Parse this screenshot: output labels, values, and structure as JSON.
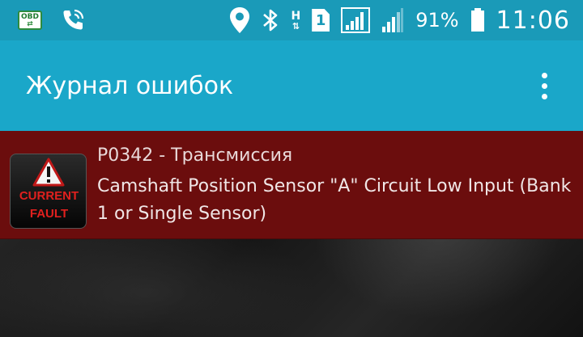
{
  "status_bar": {
    "obd_label": "OBD",
    "network_label": "H",
    "sim_label": "1",
    "battery_percent": "91%",
    "time": "11:06",
    "icons": [
      "obd-icon",
      "phone-wifi-icon",
      "location-icon",
      "bluetooth-icon",
      "network-h-icon",
      "sim-1-icon",
      "signal-icon",
      "signal-icon",
      "battery-icon"
    ]
  },
  "app_bar": {
    "title": "Журнал ошибок",
    "menu_icon": "overflow-menu-icon"
  },
  "errors": [
    {
      "icon_line1": "CURRENT",
      "icon_line2": "FAULT",
      "code_line": "P0342 - Трансмиссия",
      "description": "Camshaft Position Sensor \"A\" Circuit Low Input (Bank 1 or Single Sensor)"
    }
  ],
  "colors": {
    "status_bar": "#1a9ab8",
    "app_bar": "#1aa7c9",
    "error_row": "#6b0d0d",
    "fault_red": "#e0201e"
  }
}
